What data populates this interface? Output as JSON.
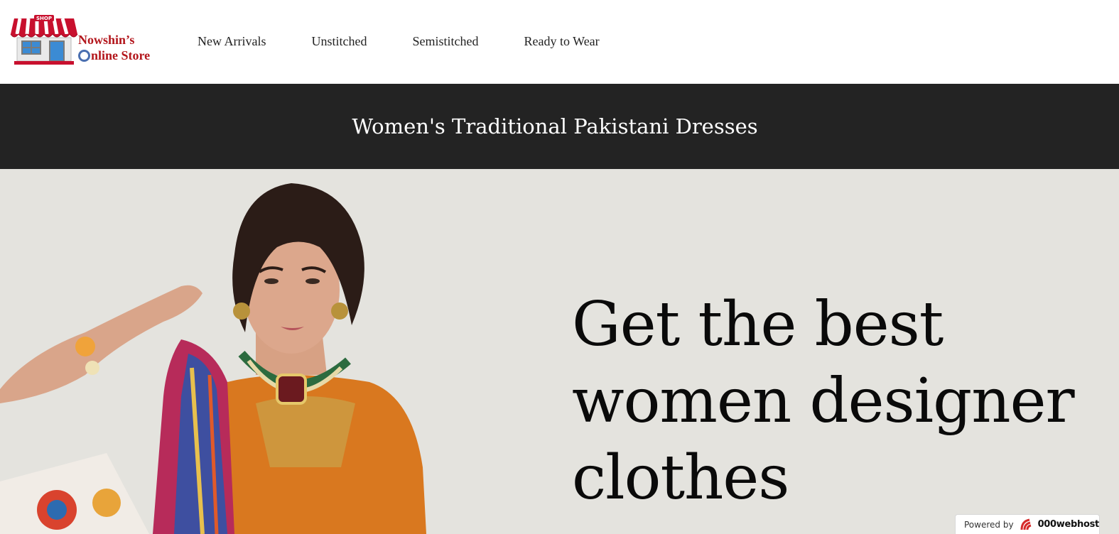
{
  "header": {
    "logo": {
      "badge": "SHOP",
      "line1": "Nowshin’s",
      "line2_rest": "nline Store"
    },
    "nav": [
      {
        "label": "New Arrivals"
      },
      {
        "label": "Unstitched"
      },
      {
        "label": "Semistitched"
      },
      {
        "label": "Ready to Wear"
      }
    ]
  },
  "banner": {
    "title": "Women's Traditional Pakistani Dresses"
  },
  "hero": {
    "headline_line1": "Get the best",
    "headline_line2": "women designer",
    "headline_line3": "clothes"
  },
  "footer_badge": {
    "label": "Powered by",
    "brand": "000webhost"
  },
  "colors": {
    "logo_red": "#b3161c",
    "banner_bg": "#232323",
    "hero_bg": "#e4e3de"
  },
  "icons": {
    "logo": "shop-storefront-icon",
    "host": "webhost-logo-icon"
  }
}
